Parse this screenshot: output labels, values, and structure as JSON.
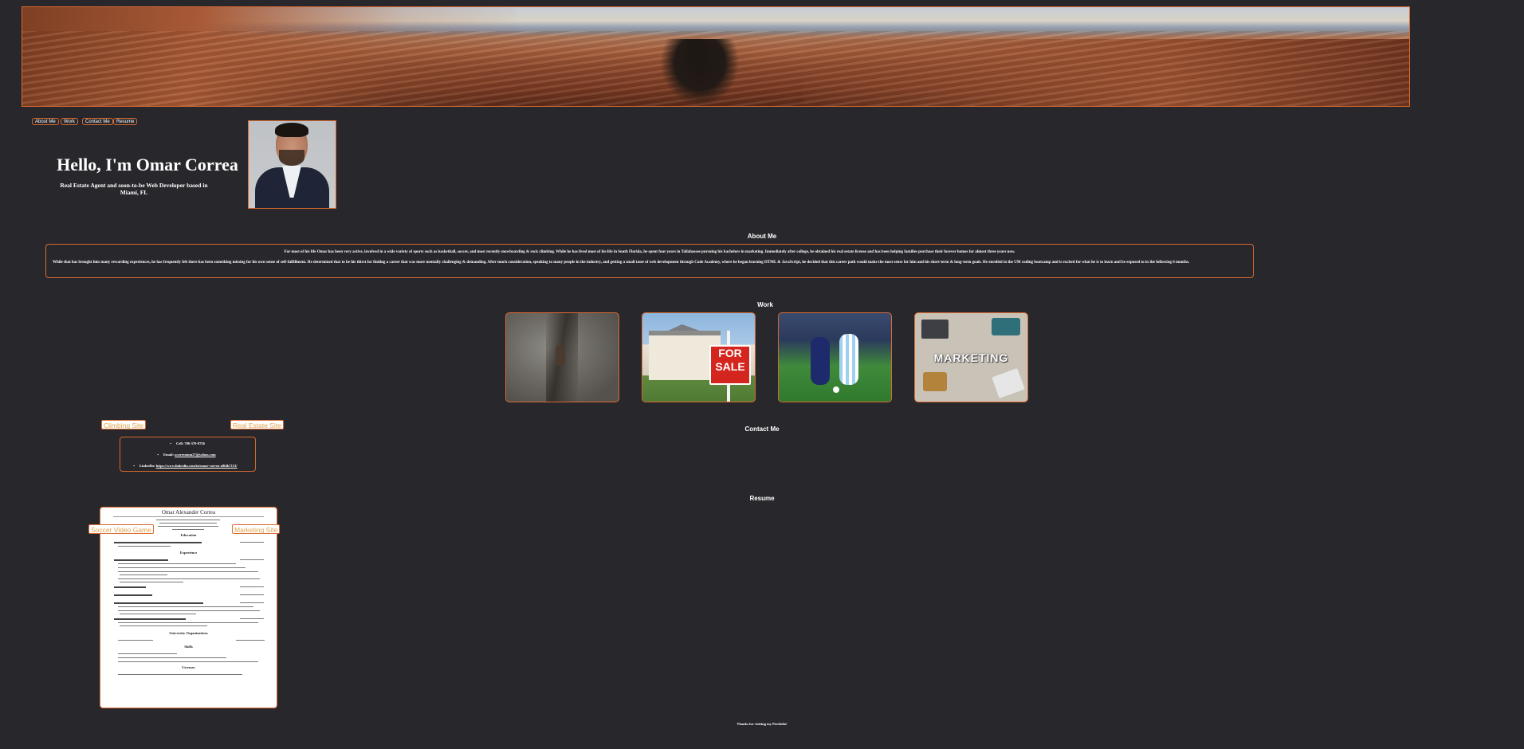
{
  "nav": {
    "items": [
      "About Me",
      "Work",
      "Contact Me",
      "Resume"
    ]
  },
  "hero": {
    "title": "Hello, I'm Omar Correa",
    "subtitle": "Real Estate Agent and soon-to-be Web Developer based in Miami, FL"
  },
  "about": {
    "heading": "About Me",
    "paragraph1": "For most of his life Omar has been very active, involved in a wide variety of sports such as basketball, soccer, and most recently snowboarding & rock climbing. While he has lived most of his life in South Florida, he spent four years in Tallahassee pursuing his bachelors in marketing. Immediately after college, he obtained his real estate license and has been helping families purchase their forever homes for almost three years now.",
    "paragraph2": "While that has brought him many rewarding experiences, he has frequently felt there has been something missing for his own sense of self-fulfillment. He determined that to be his thirst for finding a career that was more mentally challenging & demanding. After much consideration, speaking to many people in the industry, and getting a small taste of web development through Code Academy, where he began learning HTML & JavaScript, he decided that this career path would make the most sense for him and his short-term & long-term goals. He enrolled in the UM coding bootcamp and is excited for what he is to learn and be exposed to in the following 6 months."
  },
  "work": {
    "heading": "Work",
    "tiles": [
      {
        "name": "climbing",
        "icon": "climbing-photo"
      },
      {
        "name": "real-estate",
        "icon": "for-sale-photo",
        "sign_text": "FOR SALE"
      },
      {
        "name": "soccer",
        "icon": "soccer-photo"
      },
      {
        "name": "marketing",
        "icon": "marketing-photo",
        "overlay_text": "MARKETING"
      }
    ],
    "links": {
      "climbing": "Climbing Site",
      "real_estate": "Real Estate Site",
      "soccer": "Soccer Video Game",
      "marketing": "Marketing Site"
    }
  },
  "contact": {
    "heading": "Contact Me",
    "cell_label": "Cell: 786-370-9756",
    "email_label": "Email:",
    "email_value": "ocorreamm27@yahoo.com",
    "linkedin_label": "LinkedIn:",
    "linkedin_value": "https://www.linkedin.com/in/omar-correa-a8f4b7131/"
  },
  "resume": {
    "heading": "Resume",
    "name": "Omar Alexander Correa",
    "sections": [
      "Education",
      "Experience",
      "University Organizations",
      "Skills",
      "Licenses"
    ]
  },
  "footer": {
    "text": "Thanks for visiting my Portfolio!"
  },
  "colors": {
    "background": "#28272c",
    "accent": "#d9692f",
    "link_text": "#e0a24a"
  }
}
